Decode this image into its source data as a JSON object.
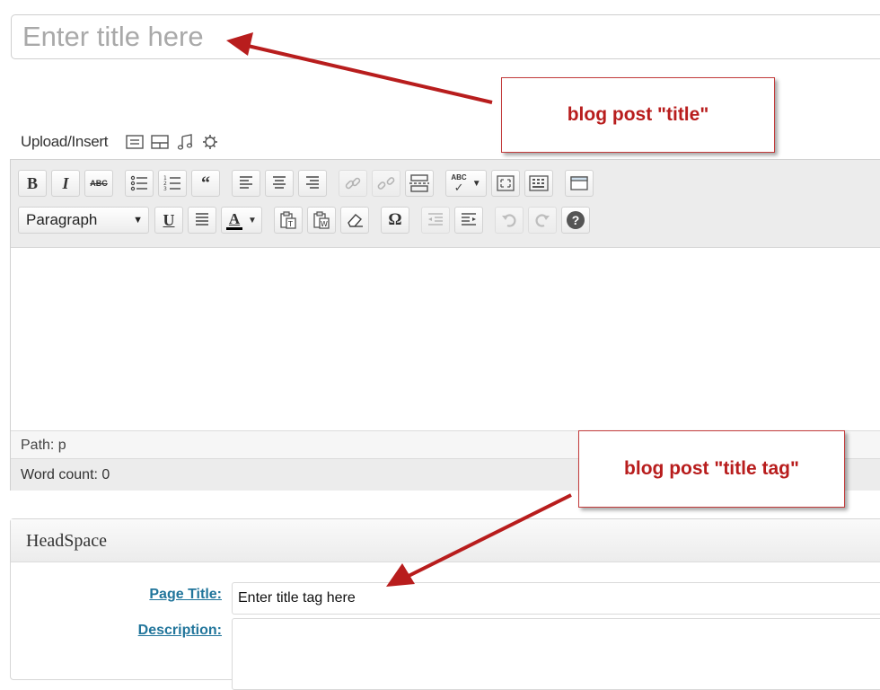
{
  "post": {
    "title_placeholder": "Enter title here"
  },
  "media": {
    "label": "Upload/Insert",
    "icons": [
      "add-image-icon",
      "add-video-icon",
      "add-audio-icon",
      "add-media-icon"
    ]
  },
  "toolbar": {
    "row1": [
      "bold",
      "italic",
      "strikethrough",
      "bulleted-list",
      "numbered-list",
      "blockquote",
      "align-left",
      "align-center",
      "align-right",
      "insert-link",
      "unlink",
      "insert-more",
      "spellcheck",
      "fullscreen",
      "kitchen-sink",
      "insert-table"
    ],
    "row2": [
      "format",
      "underline",
      "justify",
      "text-color",
      "paste-text",
      "paste-word",
      "clear-formatting",
      "special-character",
      "outdent",
      "indent",
      "undo",
      "redo",
      "help"
    ],
    "bold_glyph": "B",
    "italic_glyph": "I",
    "strike_glyph": "ABC",
    "quote_glyph": "66",
    "underline_glyph": "U",
    "color_glyph": "A",
    "omega_glyph": "Ω",
    "help_glyph": "?",
    "spell_glyph": "ABC",
    "format_value": "Paragraph"
  },
  "status": {
    "path": "Path: p",
    "word_count": "Word count: 0"
  },
  "annotations": {
    "title": "blog post \"title\"",
    "title_tag": "blog post \"title tag\"",
    "color": "#b81d1d"
  },
  "headspace": {
    "title": "HeadSpace",
    "page_title_label": "Page Title:",
    "page_title_value": "Enter title tag here",
    "description_label": "Description:"
  },
  "colors": {
    "link": "#21759b",
    "annotation": "#b81d1d",
    "toolbar_bg": "#ececec"
  }
}
